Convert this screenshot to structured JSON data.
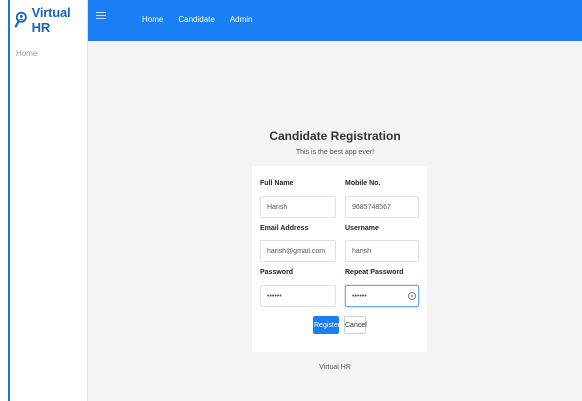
{
  "brand": {
    "name": "Virtual HR",
    "logo_icon": "person-magnifier-icon",
    "color": "#1565c0"
  },
  "sidebar": {
    "items": [
      {
        "label": "Home"
      }
    ]
  },
  "topbar": {
    "background": "#1a7ff2",
    "menu_icon": "hamburger-icon",
    "nav": [
      {
        "label": "Home"
      },
      {
        "label": "Candidate"
      },
      {
        "label": "Admin"
      }
    ]
  },
  "form": {
    "title": "Candidate Registration",
    "subtitle": "This is the best app ever!",
    "fields": {
      "full_name": {
        "label": "Full Name",
        "value": "Harish"
      },
      "mobile": {
        "label": "Mobile No.",
        "value": "9685748567"
      },
      "email": {
        "label": "Email Address",
        "value": "harish@gmail.com"
      },
      "username": {
        "label": "Username",
        "value": "harish"
      },
      "password": {
        "label": "Password",
        "value": "harish"
      },
      "repeat_password": {
        "label": "Repeat Password",
        "value": "harish",
        "toggle_icon": "eye-icon"
      }
    },
    "buttons": {
      "register": "Register",
      "cancel": "Cancel"
    }
  },
  "footer": {
    "text": "Virtual HR"
  }
}
